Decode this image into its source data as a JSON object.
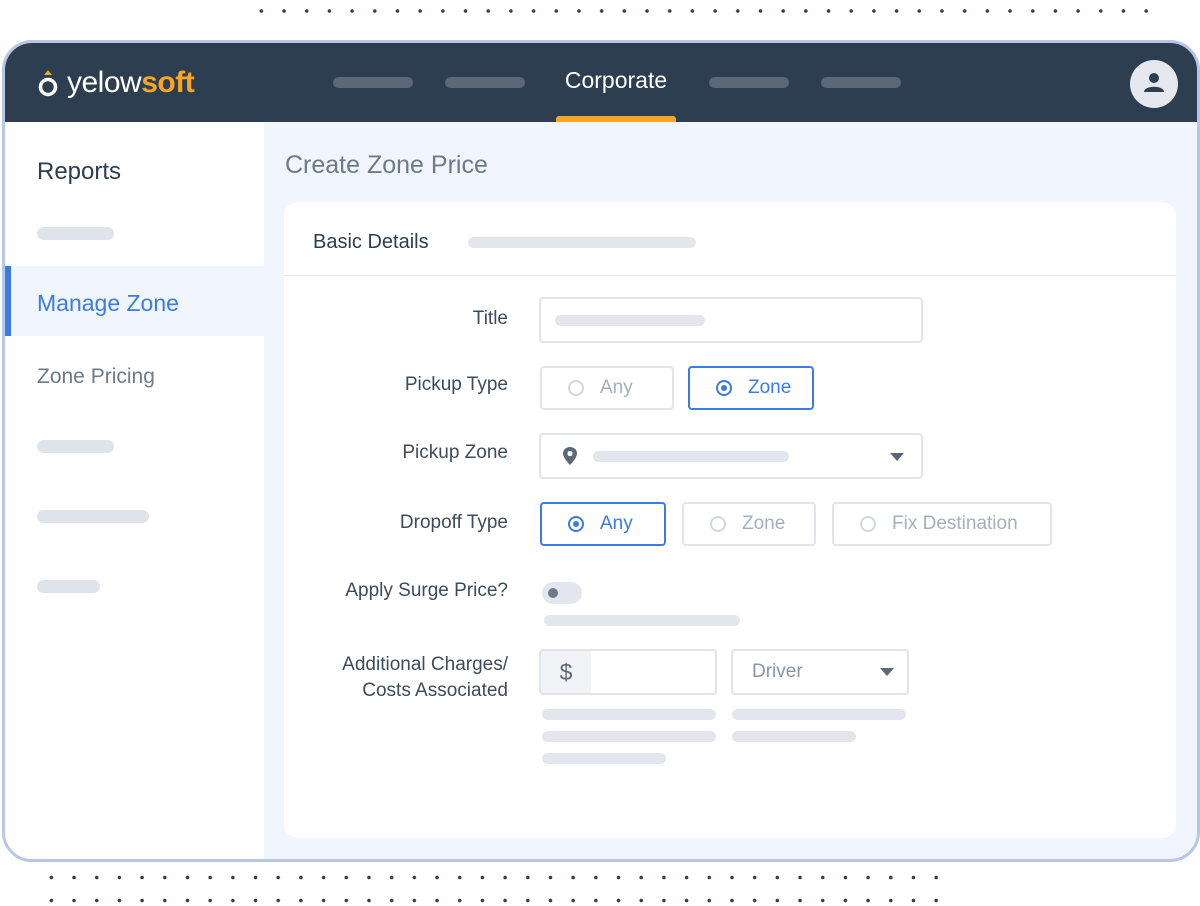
{
  "brand": {
    "name_part1": "yelow",
    "name_part2": "soft"
  },
  "nav": {
    "active_label": "Corporate"
  },
  "sidebar": {
    "title": "Reports",
    "active_item": "Manage Zone",
    "item": "Zone Pricing"
  },
  "page": {
    "title": "Create Zone Price"
  },
  "form": {
    "section_title": "Basic Details",
    "title_label": "Title",
    "pickup_type_label": "Pickup Type",
    "pickup_type_options": [
      "Any",
      "Zone"
    ],
    "pickup_type_selected": "Zone",
    "pickup_zone_label": "Pickup Zone",
    "dropoff_type_label": "Dropoff Type",
    "dropoff_type_options": [
      "Any",
      "Zone",
      "Fix Destination"
    ],
    "dropoff_type_selected": "Any",
    "surge_label": "Apply Surge Price?",
    "surge_enabled": false,
    "charges_label_line1": "Additional Charges/",
    "charges_label_line2": "Costs Associated",
    "currency_symbol": "$",
    "charge_party": "Driver"
  },
  "colors": {
    "topbar": "#2d3e50",
    "accent": "#f6a623",
    "primary": "#3b7be8",
    "window_border": "#b8c6e6"
  },
  "icons": {
    "logo": "yelowsoft-logo-icon",
    "avatar": "user-icon",
    "location": "map-pin-icon",
    "dropdown": "caret-down-icon"
  }
}
